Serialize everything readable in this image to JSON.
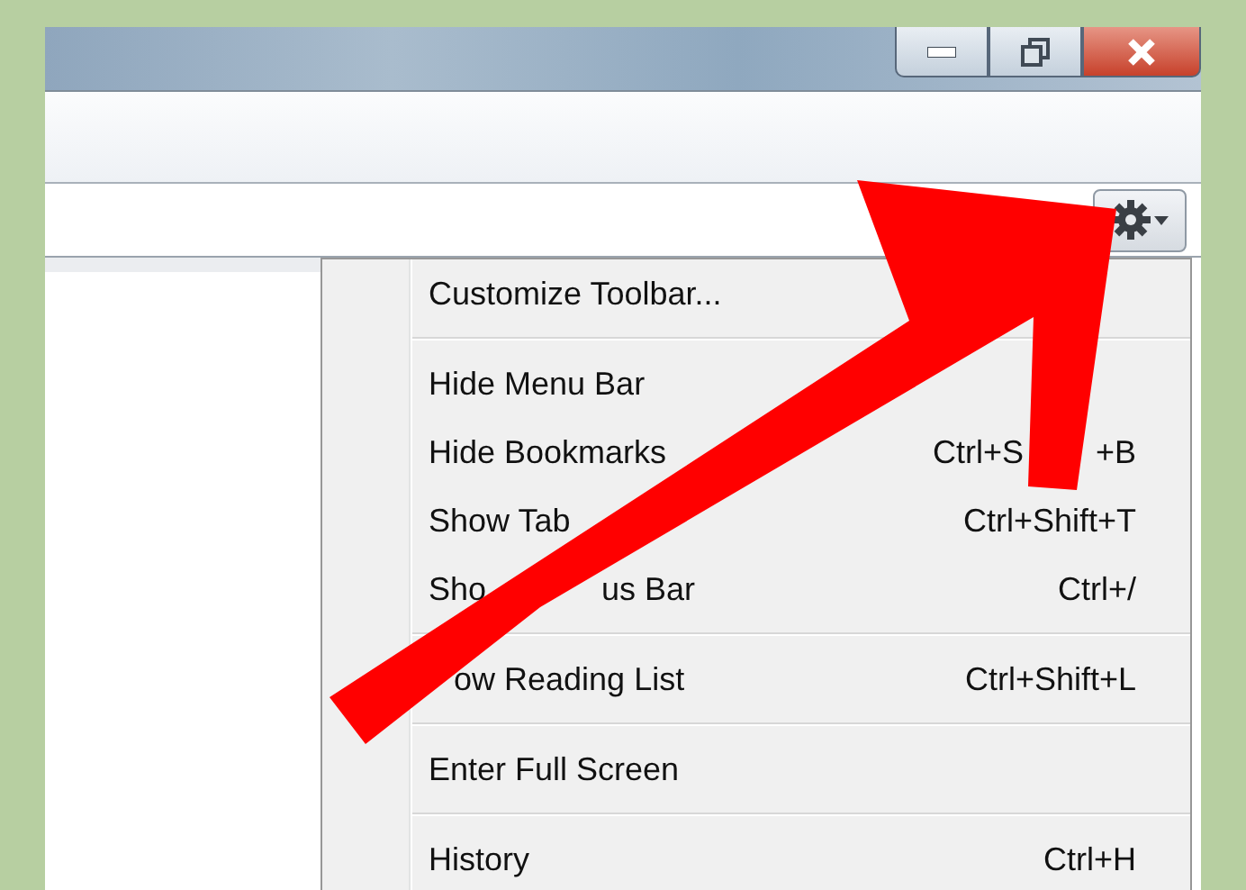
{
  "window": {
    "caption_buttons": [
      {
        "kind": "minimize"
      },
      {
        "kind": "restore"
      },
      {
        "kind": "close"
      }
    ]
  },
  "toolbar": {
    "settings_button": {
      "expanded": true
    }
  },
  "menu": {
    "items": [
      {
        "kind": "item",
        "label": [
          "Customize Toolbar..."
        ]
      },
      {
        "kind": "separator"
      },
      {
        "kind": "item",
        "label": [
          "Hide Menu Bar"
        ]
      },
      {
        "kind": "item",
        "label": [
          "Hide Bookmarks"
        ],
        "shortcut": [
          "Ctrl+S",
          "+B"
        ]
      },
      {
        "kind": "item",
        "label": [
          "Show Tab"
        ],
        "shortcut": [
          "Ctrl+Shift+T"
        ]
      },
      {
        "kind": "item",
        "label": [
          "Sho",
          "us Bar"
        ],
        "shortcut": [
          "Ctrl+/"
        ]
      },
      {
        "kind": "separator"
      },
      {
        "kind": "item",
        "label": [
          "ow Reading List"
        ],
        "shortcut": [
          "Ctrl+Shift+L"
        ]
      },
      {
        "kind": "separator"
      },
      {
        "kind": "item",
        "label": [
          "Enter Full Screen"
        ]
      },
      {
        "kind": "separator"
      },
      {
        "kind": "item",
        "label": [
          "History"
        ],
        "shortcut": [
          "Ctrl+H"
        ]
      }
    ]
  },
  "annotation": {
    "kind": "arrow"
  }
}
